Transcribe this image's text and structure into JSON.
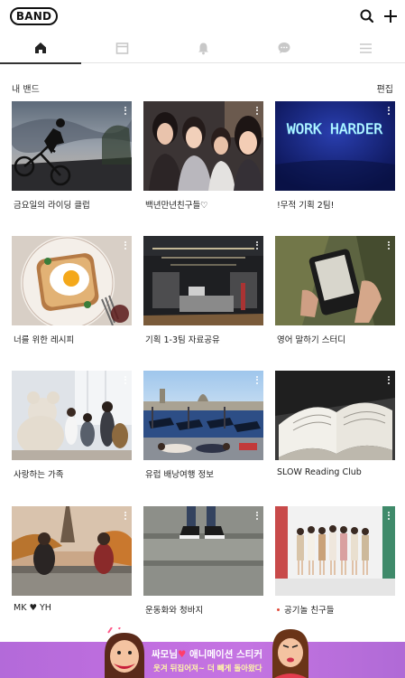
{
  "header": {
    "logo_text": "BAND",
    "icons": [
      "search-icon",
      "plus-icon"
    ]
  },
  "tabs": [
    {
      "name": "home",
      "icon": "home-icon",
      "active": true
    },
    {
      "name": "calendar",
      "icon": "calendar-icon",
      "active": false
    },
    {
      "name": "notifications",
      "icon": "bell-icon",
      "active": false
    },
    {
      "name": "chat",
      "icon": "chat-icon",
      "active": false
    },
    {
      "name": "menu",
      "icon": "menu-icon",
      "active": false
    }
  ],
  "section": {
    "title": "내 밴드",
    "edit_label": "편집"
  },
  "bands": [
    {
      "name": "금요일의 라이딩 클럽",
      "image": "bicycle-jump-photo"
    },
    {
      "name": "백년만년친구들♡",
      "image": "friends-selfie-photo"
    },
    {
      "name": "!무적 기획 2팀!",
      "image": "neon-work-harder-photo"
    },
    {
      "name": "너를 위한 레시피",
      "image": "egg-toast-photo"
    },
    {
      "name": "기획 1-3팀 자료공유",
      "image": "office-photo"
    },
    {
      "name": "영어 말하기 스터디",
      "image": "ereader-photo"
    },
    {
      "name": "사랑하는 가족",
      "image": "family-photo"
    },
    {
      "name": "유럽 배낭여행 정보",
      "image": "venice-photo"
    },
    {
      "name": "SLOW Reading Club",
      "image": "book-photo"
    },
    {
      "name": "MK ♥ YH",
      "image": "paris-couple-photo"
    },
    {
      "name": "운동화와 청바지",
      "image": "sneakers-photo"
    },
    {
      "name": "공기놀 친구들",
      "image": "group-photo",
      "new_dot": true
    }
  ],
  "banner": {
    "line1_a": "싸모님",
    "line1_heart": "♥",
    "line1_b": " 애니메이션 스티커",
    "line2": "웃겨 뒤집어져~ 더 빼게 돌아왔다",
    "colors": {
      "bg": "#c070de",
      "line2": "#fff7a8"
    }
  },
  "neon_text": "WORK HARDER"
}
